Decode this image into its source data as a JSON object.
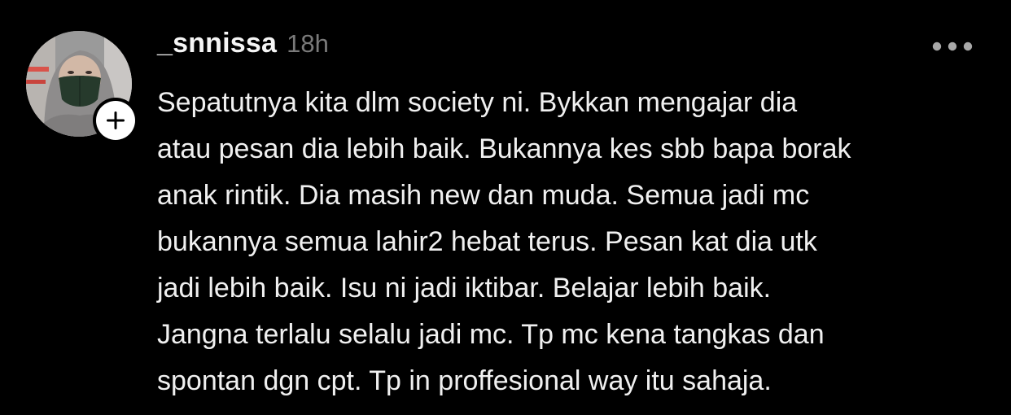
{
  "post": {
    "author": {
      "username": "_snnissa",
      "time_ago": "18h"
    },
    "body_lines": [
      "Sepatutnya kita dlm society ni. Bykkan mengajar dia",
      "atau pesan dia lebih baik. Bukannya kes sbb bapa borak",
      "anak rintik. Dia masih new dan muda. Semua jadi mc",
      "bukannya semua lahir2 hebat terus. Pesan kat dia utk",
      "jadi lebih baik. Isu ni jadi iktibar. Belajar lebih baik.",
      "Jangna terlalu selalu jadi mc. Tp mc kena tangkas dan",
      "spontan dgn cpt. Tp in proffesional way itu sahaja."
    ]
  },
  "icons": {
    "follow": "plus-icon",
    "more": "more-horizontal-icon"
  },
  "colors": {
    "background": "#000000",
    "text_primary": "#f3f3f3",
    "text_secondary": "#7a7a7a",
    "more_icon": "#a8a8a8"
  }
}
